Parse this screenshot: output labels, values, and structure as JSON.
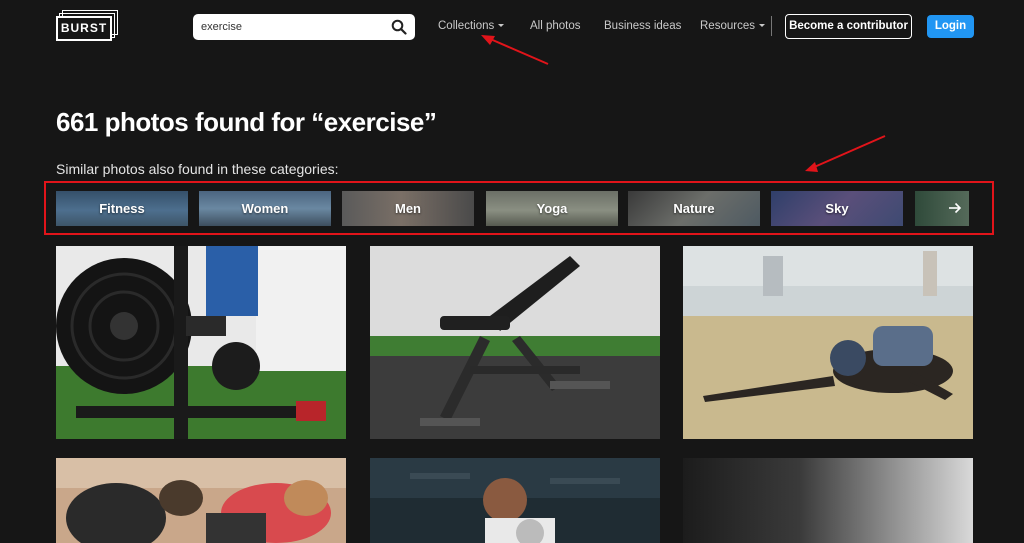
{
  "header": {
    "logo_text": "BURST",
    "search": {
      "value": "exercise",
      "placeholder": ""
    },
    "nav": [
      {
        "label": "Collections",
        "has_caret": true
      },
      {
        "label": "All photos",
        "has_caret": false
      },
      {
        "label": "Business ideas",
        "has_caret": false
      },
      {
        "label": "Resources",
        "has_caret": true
      }
    ],
    "contributor_label": "Become a contributor",
    "login_label": "Login"
  },
  "results": {
    "heading": "661 photos found for “exercise”",
    "subheading": "Similar photos also found in these categories:"
  },
  "categories": [
    "Fitness",
    "Women",
    "Men",
    "Yoga",
    "Nature",
    "Sky"
  ],
  "icons": {
    "search": "search-icon",
    "caret": "caret-down-icon",
    "next": "arrow-right-icon"
  },
  "colors": {
    "background": "#161616",
    "login_button": "#2196f3",
    "annotation": "#e1141a"
  }
}
